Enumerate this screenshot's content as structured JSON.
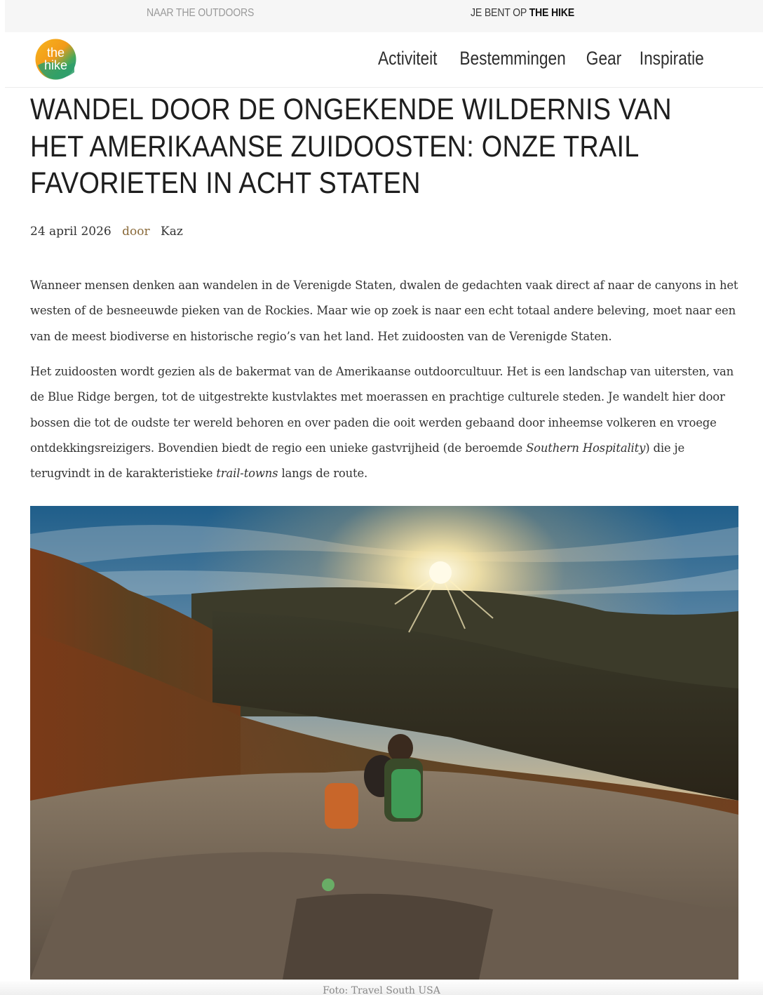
{
  "topbar": {
    "outdoors_link": "NAAR THE OUTDOORS",
    "current_prefix": "JE BENT OP ",
    "current_site": "THE HIKE"
  },
  "header": {
    "logo_text_top": "the",
    "logo_text_bottom": "hike",
    "nav": [
      "Activiteit",
      "Bestemmingen",
      "Gear",
      "Inspiratie"
    ]
  },
  "article": {
    "title": "WANDEL DOOR DE ONGEKENDE WILDERNIS VAN HET AMERIKAANSE ZUIDOOSTEN: ONZE TRAIL FAVORIETEN IN ACHT STATEN",
    "date": "24 april 2026",
    "by_label": "door",
    "author": "Kaz",
    "paragraph1": "Wanneer mensen denken aan wandelen in de Verenigde Staten, dwalen de gedachten vaak direct af naar de canyons in het westen of de besneeuwde pieken van de Rockies. Maar wie op zoek is naar een echt totaal andere beleving, moet naar een van de meest biodiverse en historische regio’s van het land. Het zuidoosten van de Verenigde Staten.",
    "paragraph2_a": "Het zuidoosten wordt gezien als de bakermat van de Amerikaanse outdoorcultuur. Het is een landschap van uitersten, van de Blue Ridge bergen, tot de uitgestrekte kustvlaktes met moerassen en prachtige culturele steden. Je wandelt hier door bossen die tot de oudste ter wereld behoren en over paden die ooit werden gebaand door inheemse volkeren en vroege ontdekkingsreizigers. Bovendien biedt de regio een unieke gastvrijheid (de beroemde ",
    "paragraph2_em1": "Southern Hospitality",
    "paragraph2_b": ") die je terugvindt in de karakteristieke ",
    "paragraph2_em2": "trail-towns",
    "paragraph2_c": " langs de route.",
    "image_caption": "Foto: Travel South USA"
  },
  "colors": {
    "logo_orange": "#f2a21b",
    "logo_green": "#3aa35a",
    "logo_teal": "#1f8fa0",
    "byline_accent": "#8a6a3a"
  }
}
